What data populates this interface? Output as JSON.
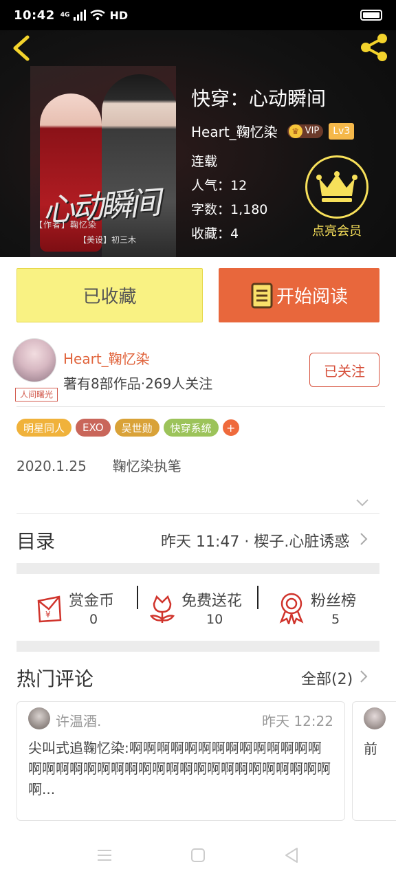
{
  "status": {
    "time": "10:42",
    "network": "4G",
    "hd": "HD"
  },
  "header": {
    "back_icon": "chevron-left-icon",
    "share_icon": "share-icon"
  },
  "book": {
    "title": "快穿：心动瞬间",
    "cover_art_title": "心动瞬间",
    "cover_credit": "【作者】鞠忆染",
    "cover_credit2": "【美设】初三木",
    "author": "Heart_鞠忆染",
    "vip_label": "VIP",
    "level": "Lv3",
    "status": "连载",
    "popularity": "人气：12",
    "words": "字数：1,180",
    "favorites": "收藏：4"
  },
  "member": {
    "label": "点亮会员",
    "icon": "crown-icon"
  },
  "buttons": {
    "collected": "已收藏",
    "read": "开始阅读",
    "read_icon": "book-icon"
  },
  "author_card": {
    "name": "Heart_鞠忆染",
    "meta": "著有8部作品·269人关注",
    "tag": "人间曙光",
    "follow": "已关注"
  },
  "tags": [
    {
      "label": "明星同人",
      "color": "#f0b23b"
    },
    {
      "label": "EXO",
      "color": "#c9665a"
    },
    {
      "label": "吴世勋",
      "color": "#d9a238"
    },
    {
      "label": "快穿系统",
      "color": "#9cc35a"
    },
    {
      "label": "+",
      "color": "#ef6a3c"
    }
  ],
  "intro": {
    "date": "2020.1.25",
    "text": "鞠忆染执笔"
  },
  "toc": {
    "title": "目录",
    "latest": "昨天 11:47 · 楔子.心脏诱惑"
  },
  "actions": [
    {
      "label": "赏金币",
      "count": "0",
      "icon": "red-envelope-icon"
    },
    {
      "label": "免费送花",
      "count": "10",
      "icon": "flower-icon"
    },
    {
      "label": "粉丝榜",
      "count": "5",
      "icon": "medal-icon"
    }
  ],
  "comments": {
    "title": "热门评论",
    "all": "全部(2)",
    "items": [
      {
        "user": "许温酒.",
        "time": "昨天 12:22",
        "text": "尖叫式追鞠忆染:啊啊啊啊啊啊啊啊啊啊啊啊啊啊啊啊啊啊啊啊啊啊啊啊啊啊啊啊啊啊啊啊啊啊啊啊啊..."
      },
      {
        "text": "前"
      }
    ]
  },
  "colors": {
    "accent": "#e8673c",
    "gold": "#f7e05a",
    "collected_bg": "#f9f283"
  }
}
